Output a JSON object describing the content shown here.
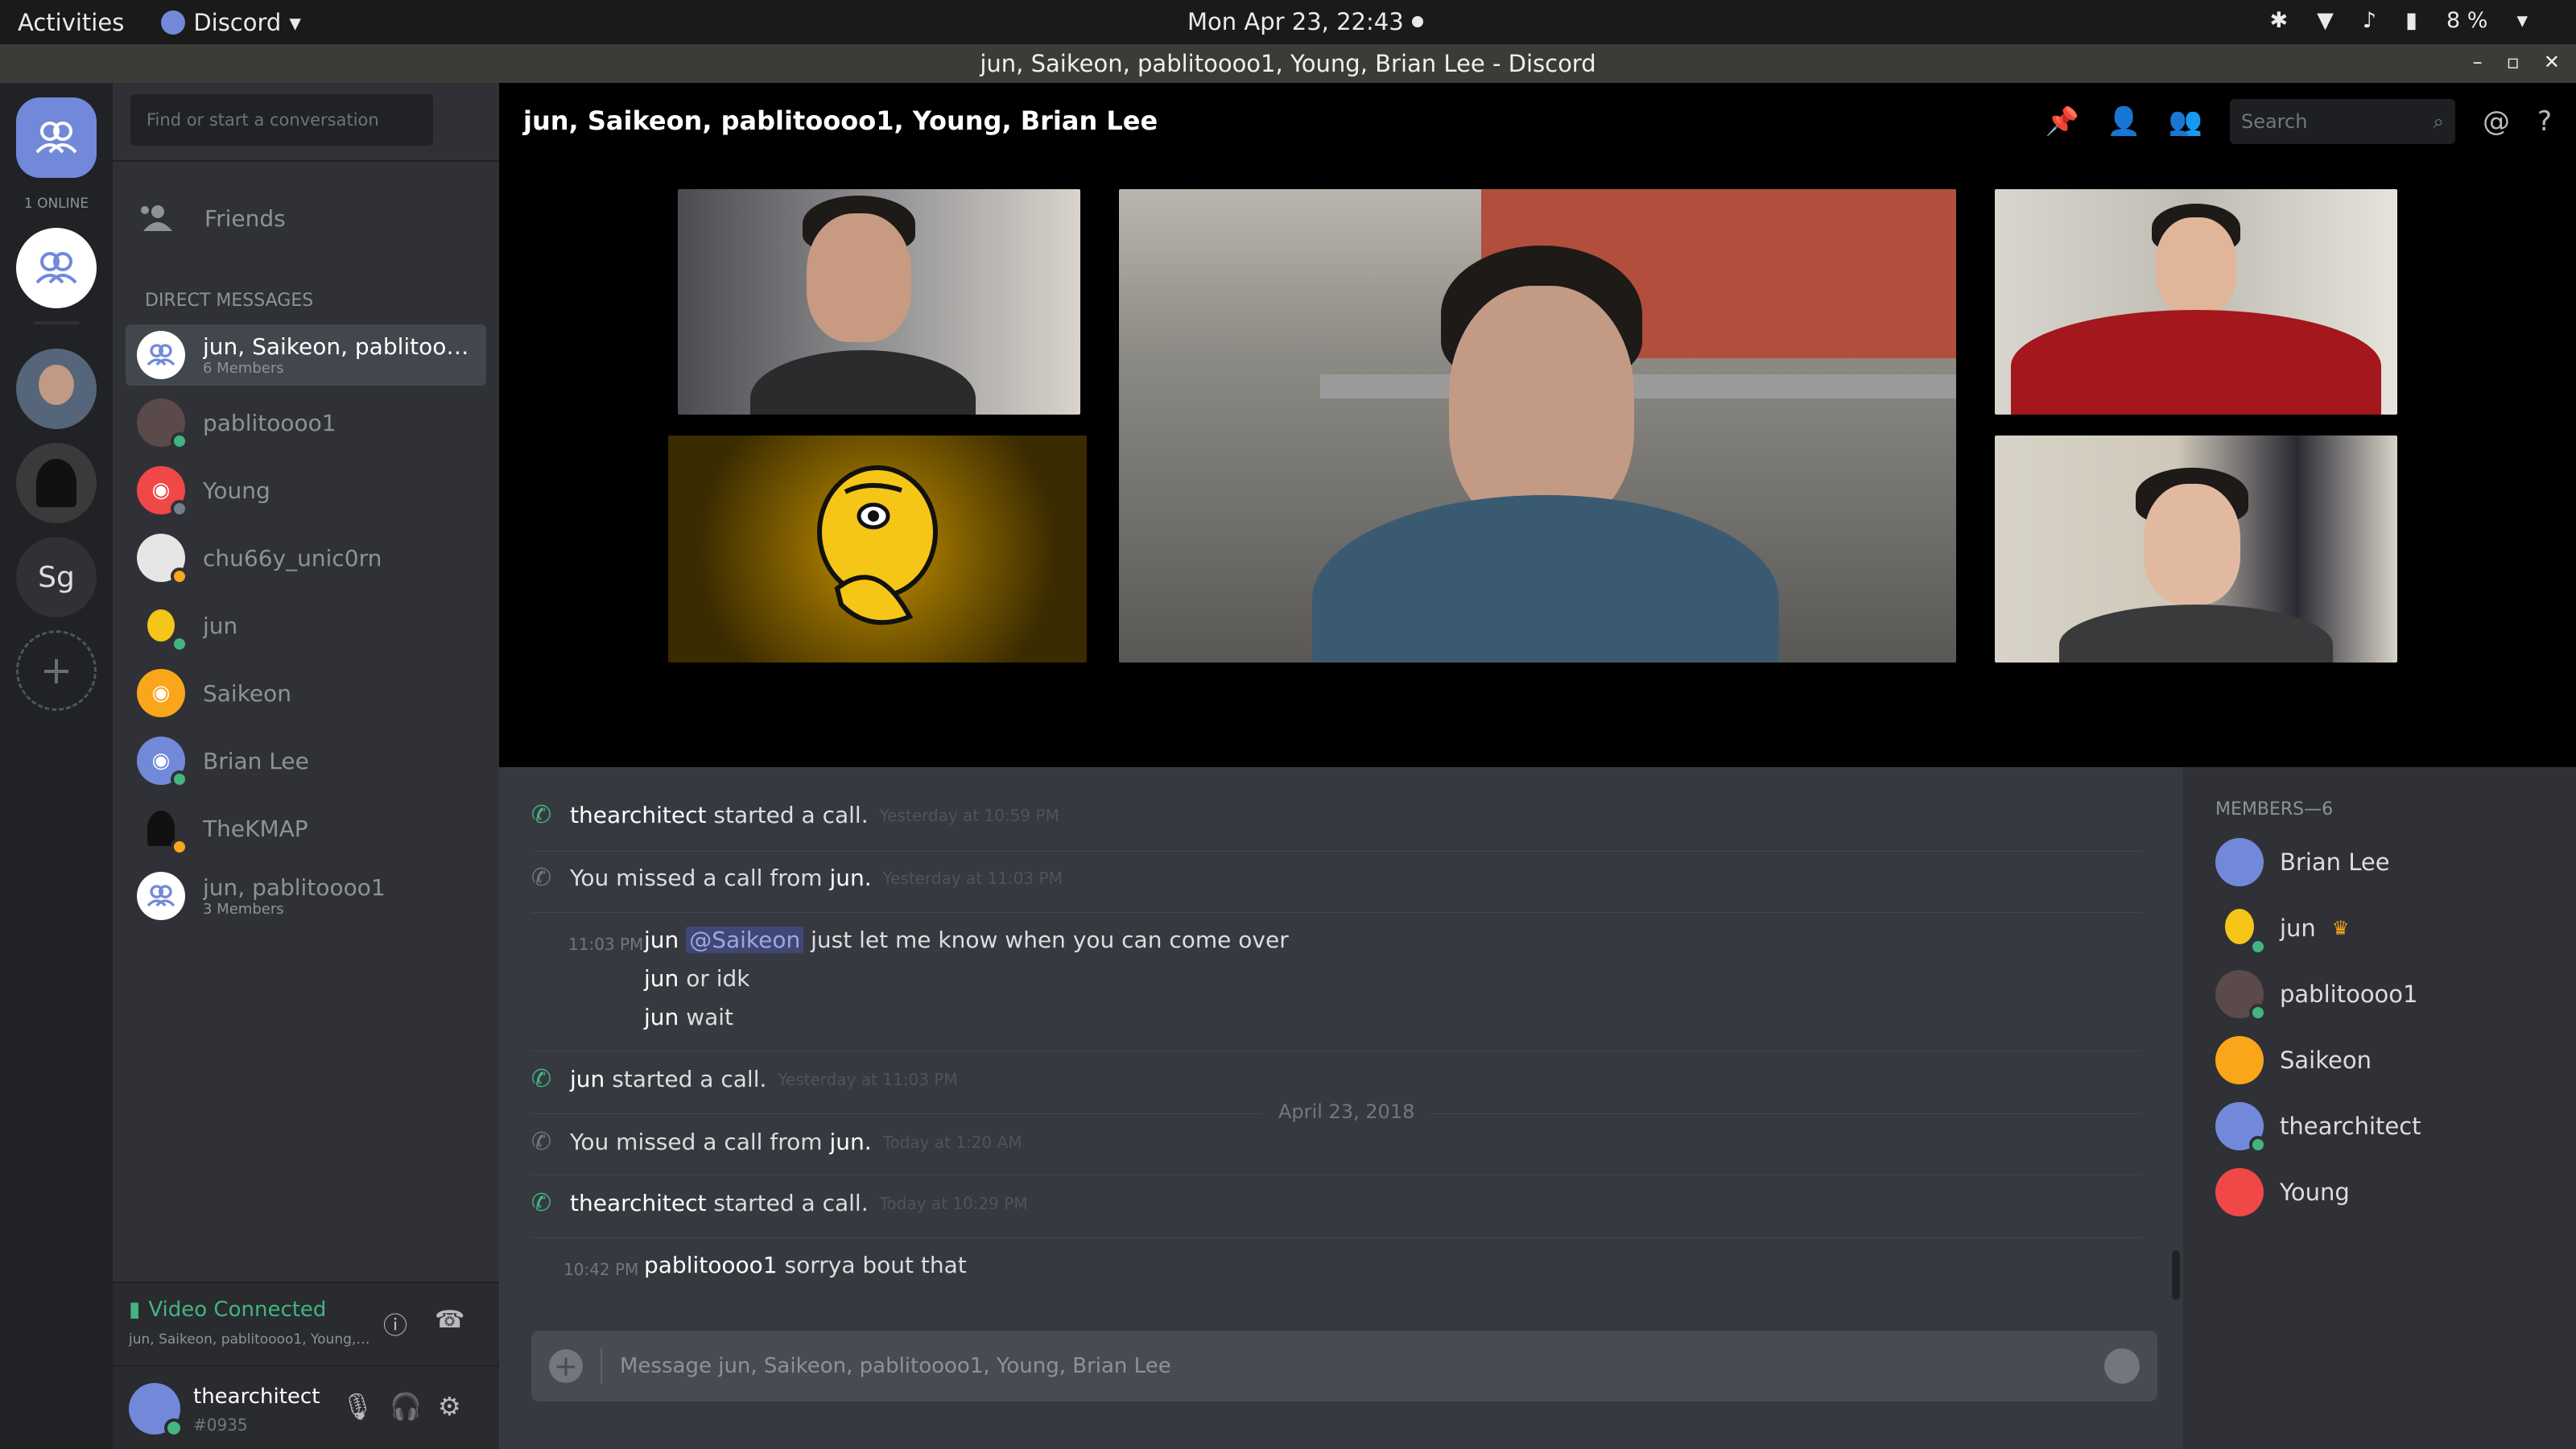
{
  "system_bar": {
    "activities": "Activities",
    "app_name": "Discord",
    "clock": "Mon Apr 23, 22:43",
    "battery": "8 %"
  },
  "window": {
    "title": "jun, Saikeon, pablitoooo1, Young, Brian Lee - Discord"
  },
  "guilds": {
    "online_label": "1 ONLINE",
    "server_initials": "Sg"
  },
  "channels": {
    "search_placeholder": "Find or start a conversation",
    "friends_label": "Friends",
    "dm_header": "DIRECT MESSAGES",
    "dms": [
      {
        "name": "jun, Saikeon, pablitoooo...",
        "sub": "6 Members"
      },
      {
        "name": "pablitoooo1",
        "sub": ""
      },
      {
        "name": "Young",
        "sub": ""
      },
      {
        "name": "chu66y_unic0rn",
        "sub": ""
      },
      {
        "name": "jun",
        "sub": ""
      },
      {
        "name": "Saikeon",
        "sub": ""
      },
      {
        "name": "Brian Lee",
        "sub": ""
      },
      {
        "name": "TheKMAP",
        "sub": ""
      },
      {
        "name": "jun, pablitoooo1",
        "sub": "3 Members"
      }
    ]
  },
  "voice": {
    "status": "Video Connected",
    "channel": "jun, Saikeon, pablitoooo1, Young, ..."
  },
  "user": {
    "name": "thearchitect",
    "tag": "#0935"
  },
  "call": {
    "header": "jun, Saikeon, pablitoooo1, Young, Brian Lee",
    "search_placeholder": "Search"
  },
  "messages": {
    "m1": {
      "user": "thearchitect",
      "text": "started a call.",
      "time": "Yesterday at 10:59 PM"
    },
    "m2": {
      "prefix": "You missed a call from",
      "user": "jun.",
      "time": "Yesterday at 11:03 PM"
    },
    "m3": {
      "time": "11:03 PM",
      "user": "jun",
      "mention": "@Saikeon",
      "text": "just let me know when you can come over"
    },
    "m4": {
      "user": "jun",
      "text": "or idk"
    },
    "m5": {
      "user": "jun",
      "text": "wait"
    },
    "m6": {
      "user": "jun",
      "text": "started a call.",
      "time": "Yesterday at 11:03 PM"
    },
    "date_divider": "April 23, 2018",
    "m7": {
      "prefix": "You missed a call from",
      "user": "jun.",
      "time": "Today at 1:20 AM"
    },
    "m8": {
      "user": "thearchitect",
      "text": "started a call.",
      "time": "Today at 10:29 PM"
    },
    "m9": {
      "time": "10:42 PM",
      "user": "pablitoooo1",
      "text": "sorrya bout that"
    },
    "input_placeholder": "Message jun, Saikeon, pablitoooo1, Young, Brian Lee"
  },
  "members": {
    "header": "MEMBERS—6",
    "list": [
      "Brian Lee",
      "jun",
      "pablitoooo1",
      "Saikeon",
      "thearchitect",
      "Young"
    ]
  },
  "colors": {
    "blurple": "#7289da",
    "online": "#43b581",
    "idle": "#faa61a",
    "dnd": "#f04747",
    "red_avatar": "#f04747",
    "orange_avatar": "#faa61a"
  }
}
